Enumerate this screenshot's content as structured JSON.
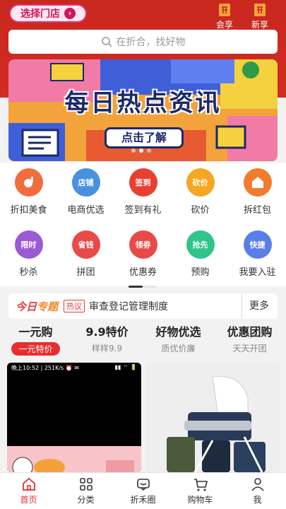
{
  "header": {
    "store_button": "选择门店",
    "actions": [
      {
        "label": "会享",
        "icon": "huixiang-icon"
      },
      {
        "label": "新享",
        "icon": "xinxiang-icon"
      }
    ],
    "search_placeholder": "在折合，找好物"
  },
  "banner": {
    "title": "每日热点资讯",
    "button": "点击了解",
    "slide_count": 3,
    "active_slide": 2
  },
  "grid": {
    "items": [
      {
        "label": "折扣美食",
        "icon": "food-icon",
        "color": "#f26d3d",
        "glyph": ""
      },
      {
        "label": "电商优选",
        "icon": "shop-icon",
        "color": "#4a90e2",
        "glyph": "店铺"
      },
      {
        "label": "签到有礼",
        "icon": "checkin-icon",
        "color": "#e8402f",
        "glyph": "签到"
      },
      {
        "label": "砍价",
        "icon": "bargain-icon",
        "color": "#f5a623",
        "glyph": "砍价"
      },
      {
        "label": "拆红包",
        "icon": "red-packet-icon",
        "color": "#f27b2e",
        "glyph": ""
      },
      {
        "label": "秒杀",
        "icon": "flash-sale-icon",
        "color": "#9b59d6",
        "glyph": "限时"
      },
      {
        "label": "拼团",
        "icon": "group-buy-icon",
        "color": "#e84a4a",
        "glyph": "省钱"
      },
      {
        "label": "优惠券",
        "icon": "coupon-icon",
        "color": "#e84a4a",
        "glyph": "领劵"
      },
      {
        "label": "预购",
        "icon": "presale-icon",
        "color": "#2ec48a",
        "glyph": "抢先"
      },
      {
        "label": "我要入驻",
        "icon": "join-icon",
        "color": "#5a7ee8",
        "glyph": "快捷"
      }
    ]
  },
  "today": {
    "logo_a": "今日",
    "logo_b": "专题",
    "tag": "热议",
    "text": "审查登记管理制度",
    "more": "更多"
  },
  "tabs": [
    {
      "title": "一元购",
      "sub": "一元特价",
      "active": true
    },
    {
      "title": "9.9特价",
      "sub": "样样9.9",
      "active": false
    },
    {
      "title": "好物优选",
      "sub": "质优价廉",
      "active": false
    },
    {
      "title": "优惠团购",
      "sub": "天天开团",
      "active": false
    }
  ],
  "products": {
    "left_status_time": "晚上10:52 | 251K/s ⏰ ✉",
    "left_status_right": "▮▮ ⌔ 🔋"
  },
  "bottom_nav": [
    {
      "label": "首页",
      "icon": "home-icon",
      "active": true
    },
    {
      "label": "分类",
      "icon": "category-icon",
      "active": false
    },
    {
      "label": "折禾圈",
      "icon": "circle-chat-icon",
      "active": false
    },
    {
      "label": "购物车",
      "icon": "cart-icon",
      "active": false
    },
    {
      "label": "我",
      "icon": "user-icon",
      "active": false
    }
  ],
  "colors": {
    "header_red": "#c9281f",
    "accent_red": "#e62e2e"
  }
}
